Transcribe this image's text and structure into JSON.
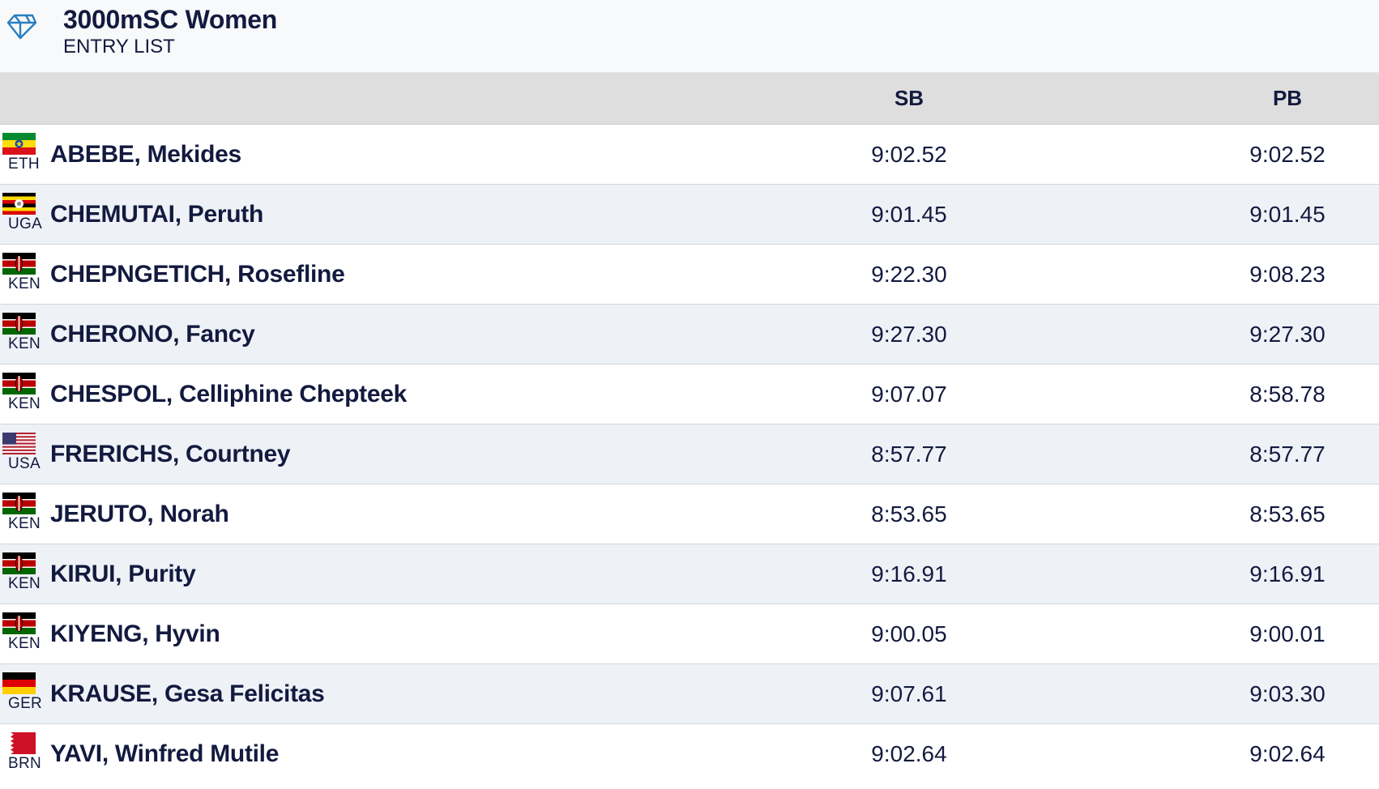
{
  "header": {
    "title": "3000mSC Women",
    "subtitle": "ENTRY LIST",
    "logo_icon": "diamond-league-icon"
  },
  "columns": {
    "sb": "SB",
    "pb": "PB"
  },
  "athletes": [
    {
      "country": "ETH",
      "flag_icon": "flag-eth-icon",
      "name": "ABEBE, Mekides",
      "sb": "9:02.52",
      "pb": "9:02.52"
    },
    {
      "country": "UGA",
      "flag_icon": "flag-uga-icon",
      "name": "CHEMUTAI, Peruth",
      "sb": "9:01.45",
      "pb": "9:01.45"
    },
    {
      "country": "KEN",
      "flag_icon": "flag-ken-icon",
      "name": "CHEPNGETICH, Rosefline",
      "sb": "9:22.30",
      "pb": "9:08.23"
    },
    {
      "country": "KEN",
      "flag_icon": "flag-ken-icon",
      "name": "CHERONO, Fancy",
      "sb": "9:27.30",
      "pb": "9:27.30"
    },
    {
      "country": "KEN",
      "flag_icon": "flag-ken-icon",
      "name": "CHESPOL, Celliphine Chepteek",
      "sb": "9:07.07",
      "pb": "8:58.78"
    },
    {
      "country": "USA",
      "flag_icon": "flag-usa-icon",
      "name": "FRERICHS, Courtney",
      "sb": "8:57.77",
      "pb": "8:57.77"
    },
    {
      "country": "KEN",
      "flag_icon": "flag-ken-icon",
      "name": "JERUTO, Norah",
      "sb": "8:53.65",
      "pb": "8:53.65"
    },
    {
      "country": "KEN",
      "flag_icon": "flag-ken-icon",
      "name": "KIRUI, Purity",
      "sb": "9:16.91",
      "pb": "9:16.91"
    },
    {
      "country": "KEN",
      "flag_icon": "flag-ken-icon",
      "name": "KIYENG, Hyvin",
      "sb": "9:00.05",
      "pb": "9:00.01"
    },
    {
      "country": "GER",
      "flag_icon": "flag-ger-icon",
      "name": "KRAUSE, Gesa Felicitas",
      "sb": "9:07.61",
      "pb": "9:03.30"
    },
    {
      "country": "BRN",
      "flag_icon": "flag-brn-icon",
      "name": "YAVI, Winfred Mutile",
      "sb": "9:02.64",
      "pb": "9:02.64"
    }
  ],
  "colors": {
    "text": "#131a3f",
    "header_bg": "#f8f9fa",
    "column_header_bg": "#dedede",
    "row_alt_bg": "#eef1f6",
    "logo": "#2a7fc1"
  }
}
